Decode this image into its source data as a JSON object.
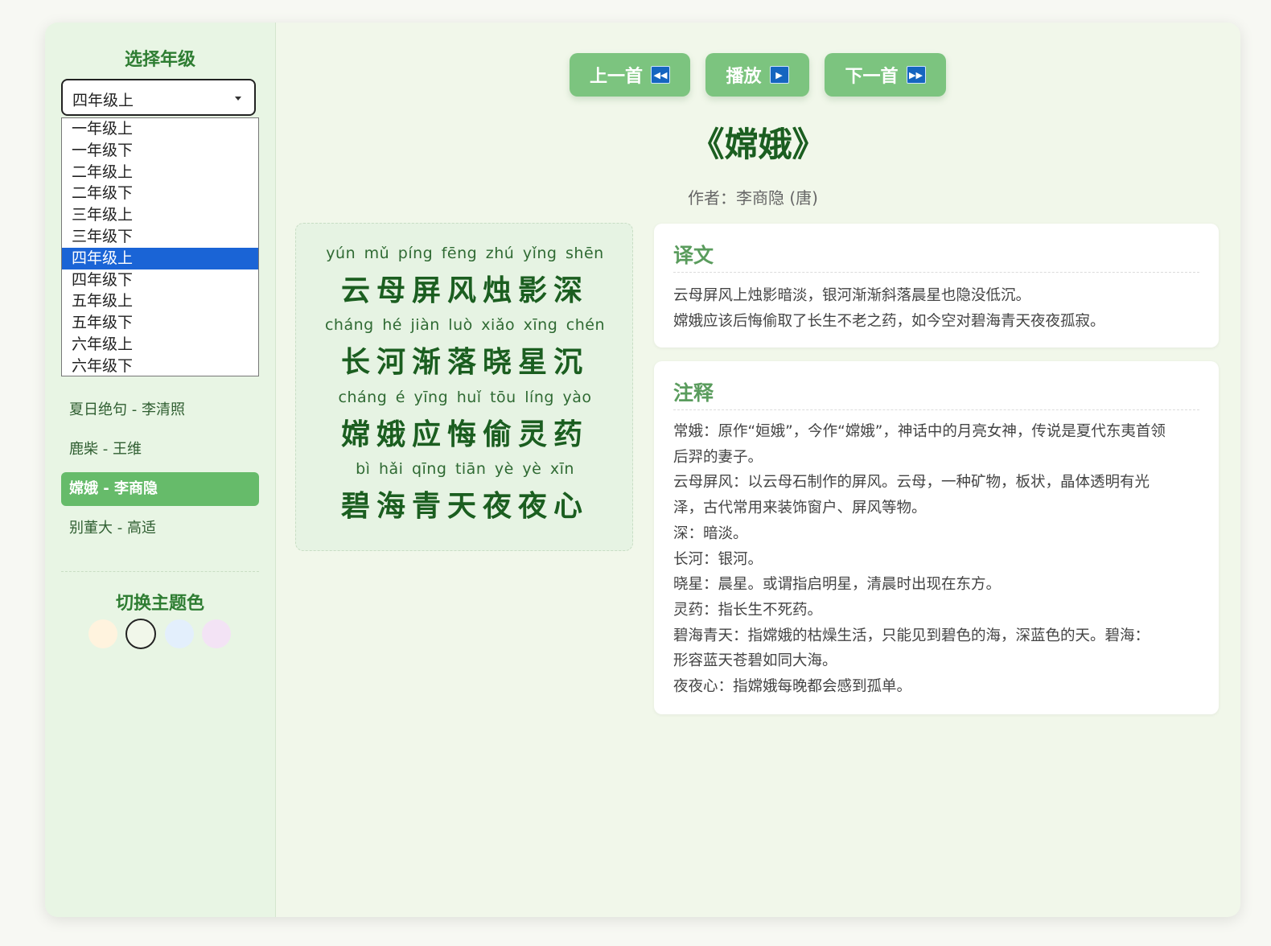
{
  "sidebar": {
    "grade_title": "选择年级",
    "selected_grade": "四年级上",
    "grade_options": [
      "一年级上",
      "一年级下",
      "二年级上",
      "二年级下",
      "三年级上",
      "三年级下",
      "四年级上",
      "四年级下",
      "五年级上",
      "五年级下",
      "六年级上",
      "六年级下"
    ],
    "poems": [
      "夏日绝句 - 李清照",
      "鹿柴 - 王维",
      "嫦娥 - 李商隐",
      "别董大 - 高适"
    ],
    "active_poem": "嫦娥 - 李商隐",
    "theme_title": "切换主题色",
    "theme_colors": [
      "#fff3de",
      "#f1f7ea",
      "#e3effc",
      "#f3e3f5"
    ],
    "active_theme_index": 1
  },
  "toolbar": {
    "prev_label": "上一首",
    "play_label": "播放",
    "next_label": "下一首",
    "prev_icon": "rewind-icon",
    "play_icon": "play-icon",
    "next_icon": "fast-forward-icon"
  },
  "poem": {
    "title": "《嫦娥》",
    "author": "作者：李商隐 (唐)",
    "lines": [
      {
        "pinyin": "yún mǔ píng fēng zhú yǐng shēn",
        "text": "云母屏风烛影深"
      },
      {
        "pinyin": "cháng hé jiàn luò xiǎo xīng chén",
        "text": "长河渐落晓星沉"
      },
      {
        "pinyin": "cháng é yīng huǐ tōu líng yào",
        "text": "嫦娥应悔偷灵药"
      },
      {
        "pinyin": "bì hǎi qīng tiān yè yè xīn",
        "text": "碧海青天夜夜心"
      }
    ]
  },
  "translation": {
    "title": "译文",
    "lines": [
      "云母屏风上烛影暗淡，银河渐渐斜落晨星也隐没低沉。",
      "嫦娥应该后悔偷取了长生不老之药，如今空对碧海青天夜夜孤寂。"
    ]
  },
  "notes": {
    "title": "注释",
    "lines": [
      "常娥：原作“姮娥”，今作“嫦娥”，神话中的月亮女神，传说是夏代东夷首领",
      "后羿的妻子。",
      "云母屏风：以云母石制作的屏风。云母，一种矿物，板状，晶体透明有光",
      "泽，古代常用来装饰窗户、屏风等物。",
      "深：暗淡。",
      "长河：银河。",
      "晓星：晨星。或谓指启明星，清晨时出现在东方。",
      "灵药：指长生不死药。",
      "碧海青天：指嫦娥的枯燥生活，只能见到碧色的海，深蓝色的天。碧海：",
      "形容蓝天苍碧如同大海。",
      "夜夜心：指嫦娥每晚都会感到孤单。"
    ]
  }
}
